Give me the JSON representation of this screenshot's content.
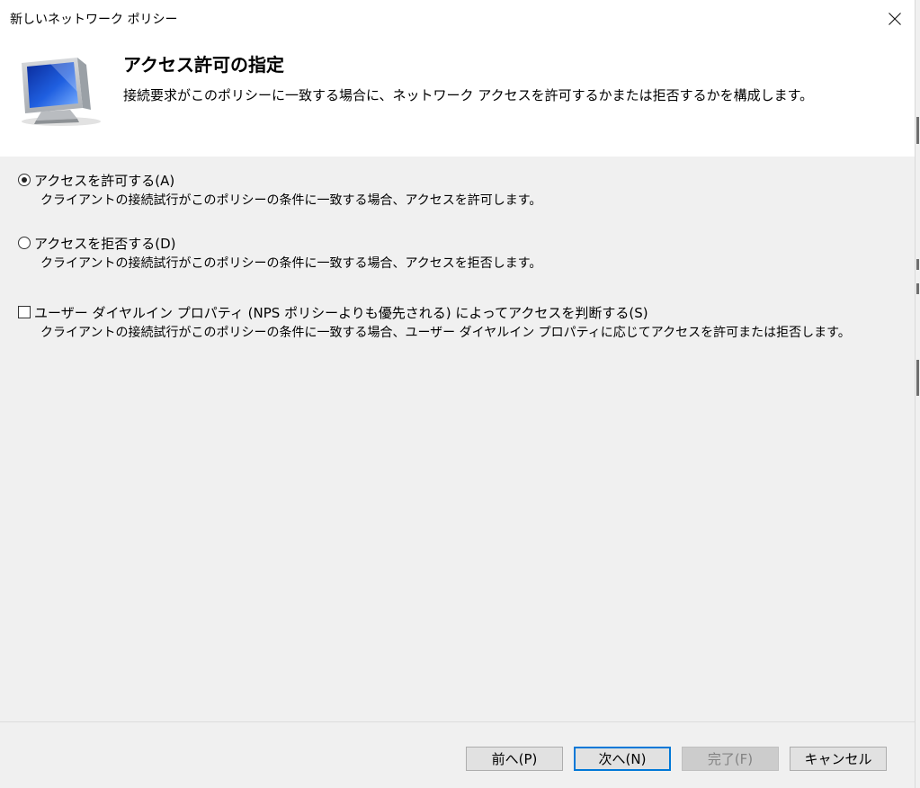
{
  "window": {
    "title": "新しいネットワーク ポリシー"
  },
  "header": {
    "icon": "monitor-icon",
    "title": "アクセス許可の指定",
    "description": "接続要求がこのポリシーに一致する場合に、ネットワーク アクセスを許可するかまたは拒否するかを構成します。"
  },
  "options": {
    "grant": {
      "label": "アクセスを許可する(A)",
      "description": "クライアントの接続試行がこのポリシーの条件に一致する場合、アクセスを許可します。",
      "selected": true
    },
    "deny": {
      "label": "アクセスを拒否する(D)",
      "description": "クライアントの接続試行がこのポリシーの条件に一致する場合、アクセスを拒否します。",
      "selected": false
    },
    "dialin": {
      "label": "ユーザー ダイヤルイン プロパティ (NPS ポリシーよりも優先される) によってアクセスを判断する(S)",
      "description": "クライアントの接続試行がこのポリシーの条件に一致する場合、ユーザー ダイヤルイン プロパティに応じてアクセスを許可または拒否します。",
      "checked": false
    }
  },
  "buttons": {
    "back": "前へ(P)",
    "next": "次へ(N)",
    "finish": "完了(F)",
    "cancel": "キャンセル"
  },
  "colors": {
    "accent": "#0078d7",
    "content_bg": "#f0f0f0"
  }
}
